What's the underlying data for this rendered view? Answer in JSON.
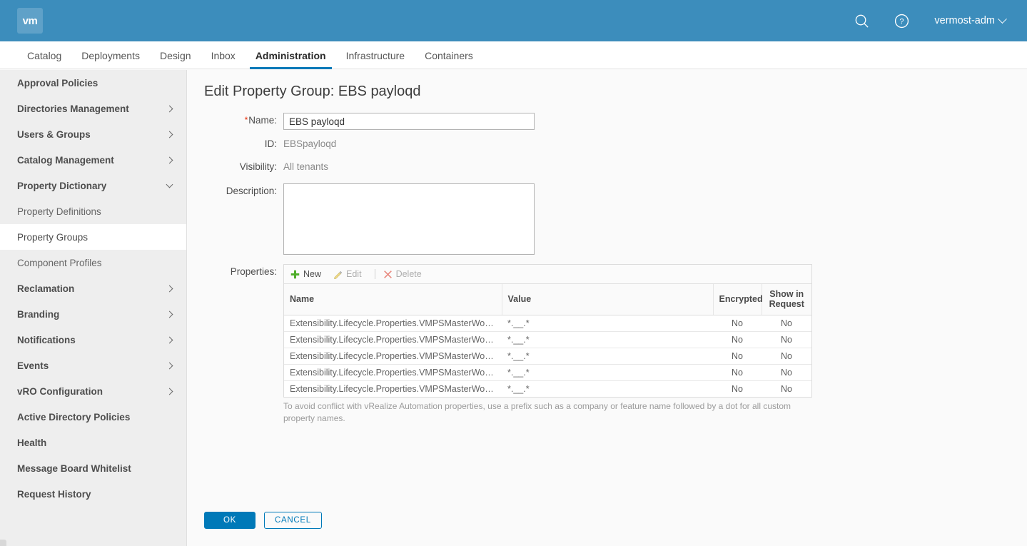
{
  "header": {
    "logo_text": "vm",
    "search_icon": "search-icon",
    "help_icon": "help-circle-icon",
    "user_label": "vermost-adm"
  },
  "tabs": [
    {
      "label": "Catalog",
      "active": false
    },
    {
      "label": "Deployments",
      "active": false
    },
    {
      "label": "Design",
      "active": false
    },
    {
      "label": "Inbox",
      "active": false
    },
    {
      "label": "Administration",
      "active": true
    },
    {
      "label": "Infrastructure",
      "active": false
    },
    {
      "label": "Containers",
      "active": false
    }
  ],
  "sidebar": {
    "items": [
      {
        "label": "Approval Policies",
        "level": 1,
        "expand": "none",
        "selected": false
      },
      {
        "label": "Directories Management",
        "level": 1,
        "expand": "right",
        "selected": false
      },
      {
        "label": "Users & Groups",
        "level": 1,
        "expand": "right",
        "selected": false
      },
      {
        "label": "Catalog Management",
        "level": 1,
        "expand": "right",
        "selected": false
      },
      {
        "label": "Property Dictionary",
        "level": 1,
        "expand": "down",
        "selected": false
      },
      {
        "label": "Property Definitions",
        "level": 2,
        "expand": "none",
        "selected": false
      },
      {
        "label": "Property Groups",
        "level": 2,
        "expand": "none",
        "selected": true
      },
      {
        "label": "Component Profiles",
        "level": 2,
        "expand": "none",
        "selected": false
      },
      {
        "label": "Reclamation",
        "level": 1,
        "expand": "right",
        "selected": false
      },
      {
        "label": "Branding",
        "level": 1,
        "expand": "right",
        "selected": false
      },
      {
        "label": "Notifications",
        "level": 1,
        "expand": "right",
        "selected": false
      },
      {
        "label": "Events",
        "level": 1,
        "expand": "right",
        "selected": false
      },
      {
        "label": "vRO Configuration",
        "level": 1,
        "expand": "right",
        "selected": false
      },
      {
        "label": "Active Directory Policies",
        "level": 1,
        "expand": "none",
        "selected": false
      },
      {
        "label": "Health",
        "level": 1,
        "expand": "none",
        "selected": false
      },
      {
        "label": "Message Board Whitelist",
        "level": 1,
        "expand": "none",
        "selected": false
      },
      {
        "label": "Request History",
        "level": 1,
        "expand": "none",
        "selected": false
      }
    ]
  },
  "main": {
    "title": "Edit Property Group: EBS payloqd",
    "fields": {
      "name_label": "Name:",
      "name_value": "EBS payloqd",
      "name_placeholder": "",
      "id_label": "ID:",
      "id_value": "EBSpayloqd",
      "visibility_label": "Visibility:",
      "visibility_value": "All tenants",
      "description_label": "Description:",
      "description_value": "",
      "description_placeholder": "",
      "properties_label": "Properties:"
    },
    "toolbar": {
      "new_label": "New",
      "edit_label": "Edit",
      "delete_label": "Delete"
    },
    "table": {
      "columns": [
        "Name",
        "Value",
        "Encrypted",
        "Show in Request"
      ],
      "rows": [
        {
          "name": "Extensibility.Lifecycle.Properties.VMPSMasterWorkfl…",
          "value": "*.__.*",
          "encrypted": "No",
          "show_in_request": "No"
        },
        {
          "name": "Extensibility.Lifecycle.Properties.VMPSMasterWorkfl…",
          "value": "*.__.*",
          "encrypted": "No",
          "show_in_request": "No"
        },
        {
          "name": "Extensibility.Lifecycle.Properties.VMPSMasterWorkfl…",
          "value": "*.__.*",
          "encrypted": "No",
          "show_in_request": "No"
        },
        {
          "name": "Extensibility.Lifecycle.Properties.VMPSMasterWorkfl…",
          "value": "*.__.*",
          "encrypted": "No",
          "show_in_request": "No"
        },
        {
          "name": "Extensibility.Lifecycle.Properties.VMPSMasterWorkfl…",
          "value": "*.__.*",
          "encrypted": "No",
          "show_in_request": "No"
        }
      ]
    },
    "hint": "To avoid conflict with vRealize Automation properties, use a prefix such as a company or feature name followed by a dot for all custom property names.",
    "buttons": {
      "ok_label": "OK",
      "cancel_label": "CANCEL"
    }
  },
  "colors": {
    "brand_blue": "#3c8dbc",
    "accent_blue": "#0079b8",
    "sidebar_bg": "#eeeeee",
    "content_bg": "#fafafa",
    "required_red": "#e62700",
    "new_green": "#60b515",
    "delete_red": "#e8897f"
  }
}
